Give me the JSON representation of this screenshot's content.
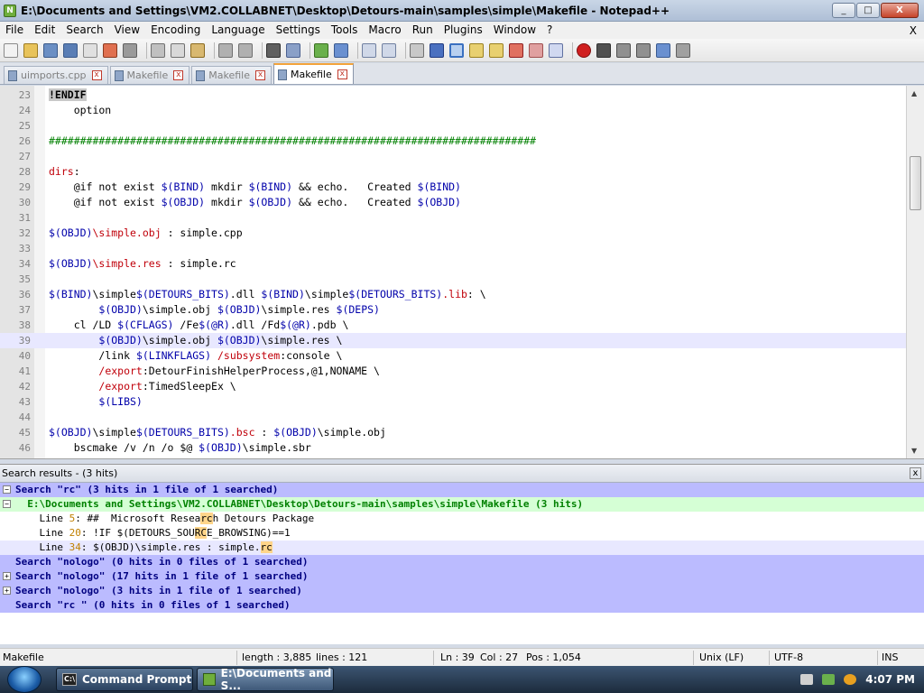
{
  "window": {
    "title": "E:\\Documents and Settings\\VM2.COLLABNET\\Desktop\\Detours-main\\samples\\simple\\Makefile - Notepad++",
    "min": "_",
    "max": "□",
    "close": "X"
  },
  "menu": [
    "File",
    "Edit",
    "Search",
    "View",
    "Encoding",
    "Language",
    "Settings",
    "Tools",
    "Macro",
    "Run",
    "Plugins",
    "Window",
    "?"
  ],
  "menu_close": "X",
  "tabs": [
    {
      "label": "uimports.cpp",
      "active": false
    },
    {
      "label": "Makefile",
      "active": false
    },
    {
      "label": "Makefile",
      "active": false
    },
    {
      "label": "Makefile",
      "active": true
    }
  ],
  "tab_close_glyph": "x",
  "editor": {
    "current_line": 39,
    "lines": [
      {
        "n": "23",
        "segs": [
          [
            "!ENDIF",
            "endif"
          ]
        ]
      },
      {
        "n": "24",
        "segs": [
          [
            "    option",
            "kw"
          ]
        ]
      },
      {
        "n": "25",
        "segs": [
          [
            "",
            "kw"
          ]
        ]
      },
      {
        "n": "26",
        "segs": [
          [
            "##############################################################################",
            "hash"
          ]
        ]
      },
      {
        "n": "27",
        "segs": [
          [
            "",
            "kw"
          ]
        ]
      },
      {
        "n": "28",
        "segs": [
          [
            "dirs",
            "red"
          ],
          [
            ":",
            "kw"
          ]
        ]
      },
      {
        "n": "29",
        "segs": [
          [
            "    @if not exist ",
            "kw"
          ],
          [
            "$(BIND)",
            "var"
          ],
          [
            " mkdir ",
            "kw"
          ],
          [
            "$(BIND)",
            "var"
          ],
          [
            " && echo.   Created ",
            "kw"
          ],
          [
            "$(BIND)",
            "var"
          ]
        ]
      },
      {
        "n": "30",
        "segs": [
          [
            "    @if not exist ",
            "kw"
          ],
          [
            "$(OBJD)",
            "var"
          ],
          [
            " mkdir ",
            "kw"
          ],
          [
            "$(OBJD)",
            "var"
          ],
          [
            " && echo.   Created ",
            "kw"
          ],
          [
            "$(OBJD)",
            "var"
          ]
        ]
      },
      {
        "n": "31",
        "segs": [
          [
            "",
            "kw"
          ]
        ]
      },
      {
        "n": "32",
        "segs": [
          [
            "$(OBJD)",
            "var"
          ],
          [
            "\\simple.obj",
            "red"
          ],
          [
            " : simple.cpp",
            "kw"
          ]
        ]
      },
      {
        "n": "33",
        "segs": [
          [
            "",
            "kw"
          ]
        ]
      },
      {
        "n": "34",
        "segs": [
          [
            "$(OBJD)",
            "var"
          ],
          [
            "\\simple.res",
            "red"
          ],
          [
            " : simple.rc",
            "kw"
          ]
        ]
      },
      {
        "n": "35",
        "segs": [
          [
            "",
            "kw"
          ]
        ]
      },
      {
        "n": "36",
        "segs": [
          [
            "$(BIND)",
            "var"
          ],
          [
            "\\simple",
            "kw"
          ],
          [
            "$(DETOURS_BITS)",
            "var"
          ],
          [
            ".dll ",
            "kw"
          ],
          [
            "$(BIND)",
            "var"
          ],
          [
            "\\simple",
            "kw"
          ],
          [
            "$(DETOURS_BITS)",
            "var"
          ],
          [
            ".lib",
            "red"
          ],
          [
            ": \\",
            "kw"
          ]
        ]
      },
      {
        "n": "37",
        "segs": [
          [
            "        ",
            "kw"
          ],
          [
            "$(OBJD)",
            "var"
          ],
          [
            "\\simple.obj ",
            "kw"
          ],
          [
            "$(OBJD)",
            "var"
          ],
          [
            "\\simple.res ",
            "kw"
          ],
          [
            "$(DEPS)",
            "var"
          ]
        ]
      },
      {
        "n": "38",
        "segs": [
          [
            "    cl /LD ",
            "kw"
          ],
          [
            "$(CFLAGS)",
            "var"
          ],
          [
            " /Fe",
            "kw"
          ],
          [
            "$(@R)",
            "var"
          ],
          [
            ".dll /Fd",
            "kw"
          ],
          [
            "$(@R)",
            "var"
          ],
          [
            ".pdb \\",
            "kw"
          ]
        ]
      },
      {
        "n": "39",
        "segs": [
          [
            "        ",
            "kw"
          ],
          [
            "$(OBJD)",
            "var"
          ],
          [
            "\\simple.obj ",
            "kw"
          ],
          [
            "$(OBJD)",
            "var"
          ],
          [
            "\\simple.res \\",
            "kw"
          ]
        ]
      },
      {
        "n": "40",
        "segs": [
          [
            "        /link ",
            "kw"
          ],
          [
            "$(LINKFLAGS)",
            "var"
          ],
          [
            " ",
            "kw"
          ],
          [
            "/subsystem",
            "red"
          ],
          [
            ":console \\",
            "kw"
          ]
        ]
      },
      {
        "n": "41",
        "segs": [
          [
            "        ",
            "kw"
          ],
          [
            "/export",
            "red"
          ],
          [
            ":DetourFinishHelperProcess,@1,NONAME \\",
            "kw"
          ]
        ]
      },
      {
        "n": "42",
        "segs": [
          [
            "        ",
            "kw"
          ],
          [
            "/export",
            "red"
          ],
          [
            ":TimedSleepEx \\",
            "kw"
          ]
        ]
      },
      {
        "n": "43",
        "segs": [
          [
            "        ",
            "kw"
          ],
          [
            "$(LIBS)",
            "var"
          ]
        ]
      },
      {
        "n": "44",
        "segs": [
          [
            "",
            "kw"
          ]
        ]
      },
      {
        "n": "45",
        "segs": [
          [
            "$(OBJD)",
            "var"
          ],
          [
            "\\simple",
            "kw"
          ],
          [
            "$(DETOURS_BITS)",
            "var"
          ],
          [
            ".bsc",
            "red"
          ],
          [
            " : ",
            "kw"
          ],
          [
            "$(OBJD)",
            "var"
          ],
          [
            "\\simple.obj",
            "kw"
          ]
        ]
      },
      {
        "n": "46",
        "segs": [
          [
            "    bscmake /v /n /o $@ ",
            "kw"
          ],
          [
            "$(OBJD)",
            "var"
          ],
          [
            "\\simple.sbr",
            "kw"
          ]
        ]
      }
    ]
  },
  "search_panel": {
    "title": "Search results - (3 hits)",
    "close": "x",
    "rows": [
      {
        "type": "hdr",
        "toggle": "−",
        "text": "Search \"rc\" (3 hits in 1 file of 1 searched)"
      },
      {
        "type": "file",
        "toggle": "−",
        "text": "  E:\\Documents and Settings\\VM2.COLLABNET\\Desktop\\Detours-main\\samples\\simple\\Makefile (3 hits)"
      },
      {
        "type": "hit",
        "pre": "    Line ",
        "num": "5",
        "mid": ": ##  Microsoft Resea",
        "hl": "rc",
        "post": "h Detours Package"
      },
      {
        "type": "hit",
        "pre": "    Line ",
        "num": "20",
        "mid": ": !IF $(DETOURS_SOU",
        "hl": "RC",
        "post": "E_BROWSING)==1"
      },
      {
        "type": "hit",
        "pre": "    Line ",
        "num": "34",
        "mid": ": $(OBJD)\\simple.res : simple.",
        "hl": "rc",
        "post": ""
      },
      {
        "type": "hdr",
        "toggle": "",
        "text": "Search \"nologo\" (0 hits in 0 files of 1 searched)"
      },
      {
        "type": "hdr",
        "toggle": "+",
        "text": "Search \"nologo\" (17 hits in 1 file of 1 searched)"
      },
      {
        "type": "hdr",
        "toggle": "+",
        "text": "Search \"nologo\" (3 hits in 1 file of 1 searched)"
      },
      {
        "type": "hdr",
        "toggle": "",
        "text": "Search \"rc \" (0 hits in 0 files of 1 searched)"
      }
    ]
  },
  "status": {
    "type": "Makefile",
    "length": "length : 3,885",
    "lines": "lines : 121",
    "ln": "Ln : 39",
    "col": "Col : 27",
    "pos": "Pos : 1,054",
    "eol": "Unix (LF)",
    "encoding": "UTF-8",
    "mode": "INS"
  },
  "taskbar": {
    "items": [
      {
        "label": "Command Prompt",
        "icon": "C:\\",
        "active": false
      },
      {
        "label": "E:\\Documents and S...",
        "icon": "",
        "active": true
      }
    ],
    "clock": "4:07 PM"
  },
  "colors": {
    "accent_tab": "#f3a33a",
    "keyword_var": "#0000aa",
    "target_red": "#c0000a",
    "search_header": "#bbbbff",
    "search_file": "#d5ffd5"
  }
}
